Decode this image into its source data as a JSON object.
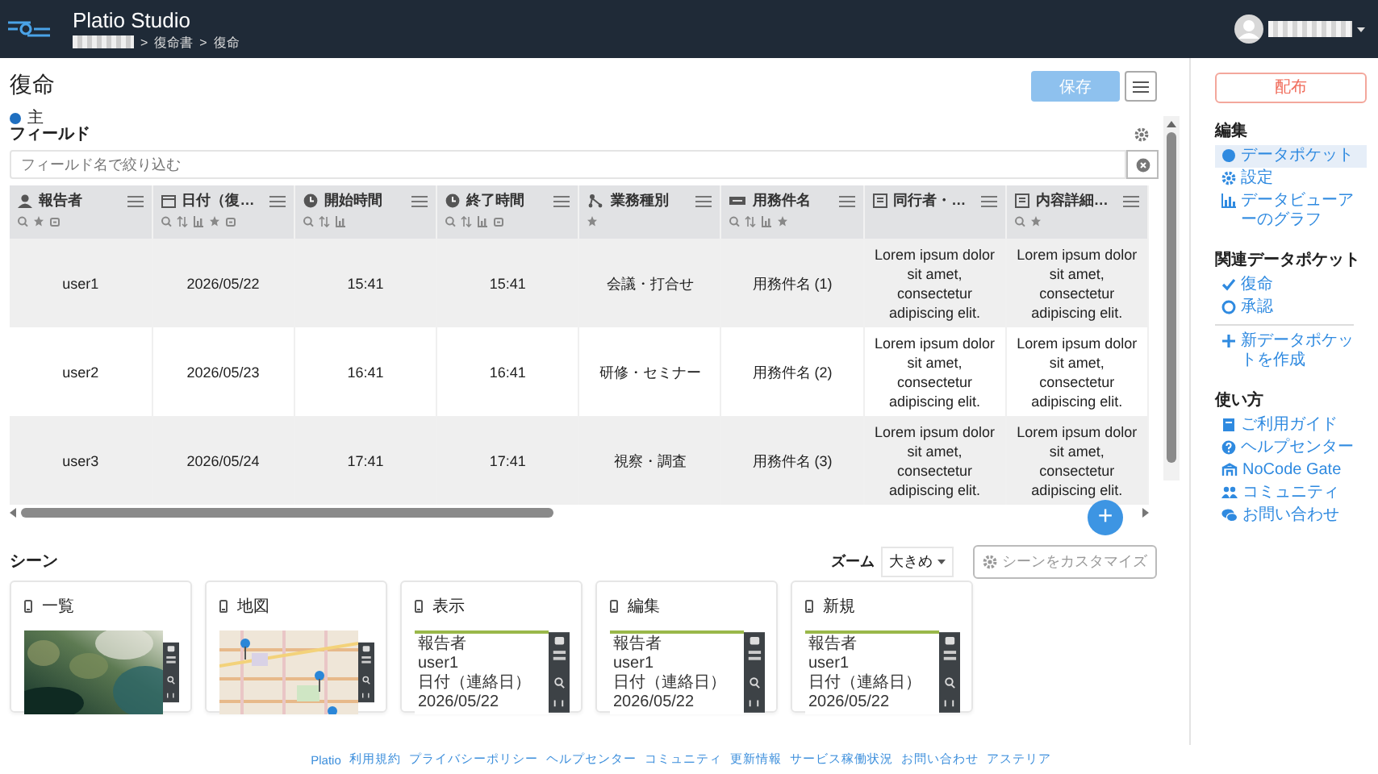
{
  "header": {
    "app_name": "Platio Studio",
    "breadcrumb": [
      "復命書",
      "復命"
    ],
    "separator": ">"
  },
  "page": {
    "title": "復命",
    "legend": {
      "label": "主",
      "color": "#1f6fc0"
    },
    "save_button": {
      "label": "保存",
      "disabled": true
    }
  },
  "fields": {
    "title": "フィールド",
    "filter_placeholder": "フィールド名で絞り込む"
  },
  "table": {
    "columns": [
      {
        "label": "報告者",
        "kind": "user",
        "searchable": true,
        "sortable": false,
        "chartable": false,
        "starred": true,
        "linked": true
      },
      {
        "label": "日付（復…",
        "kind": "date",
        "searchable": true,
        "sortable": true,
        "chartable": true,
        "starred": true,
        "linked": true
      },
      {
        "label": "開始時間",
        "kind": "time",
        "searchable": true,
        "sortable": true,
        "chartable": true,
        "starred": false,
        "linked": false
      },
      {
        "label": "終了時間",
        "kind": "time",
        "searchable": true,
        "sortable": true,
        "chartable": true,
        "starred": false,
        "linked": true
      },
      {
        "label": "業務種別",
        "kind": "choice",
        "searchable": false,
        "sortable": false,
        "chartable": false,
        "starred": true,
        "linked": false
      },
      {
        "label": "用務件名",
        "kind": "text",
        "searchable": true,
        "sortable": true,
        "chartable": true,
        "starred": true,
        "linked": false
      },
      {
        "label": "同行者・…",
        "kind": "longtext",
        "searchable": false,
        "sortable": false,
        "chartable": false,
        "starred": false,
        "linked": false
      },
      {
        "label": "内容詳細…",
        "kind": "longtext",
        "searchable": true,
        "sortable": false,
        "chartable": false,
        "starred": true,
        "linked": false
      }
    ],
    "rows": [
      {
        "cells": [
          "user1",
          "2026/05/22",
          "15:41",
          "15:41",
          "会議・打合せ",
          "用務件名 (1)",
          "Lorem ipsum dolor sit amet, consectetur adipiscing elit.",
          "Lorem ipsum dolor sit amet, consectetur adipiscing elit."
        ]
      },
      {
        "cells": [
          "user2",
          "2026/05/23",
          "16:41",
          "16:41",
          "研修・セミナー",
          "用務件名 (2)",
          "Lorem ipsum dolor sit amet, consectetur adipiscing elit.",
          "Lorem ipsum dolor sit amet, consectetur adipiscing elit."
        ]
      },
      {
        "cells": [
          "user3",
          "2026/05/24",
          "17:41",
          "17:41",
          "視察・調査",
          "用務件名 (3)",
          "Lorem ipsum dolor sit amet, consectetur adipiscing elit.",
          "Lorem ipsum dolor sit amet, consectetur adipiscing elit."
        ]
      }
    ],
    "add_button": "+"
  },
  "scenes": {
    "title": "シーン",
    "zoom_label": "ズーム",
    "zoom_value": "大きめ",
    "customize": "シーンをカスタマイズ",
    "cards": [
      {
        "title": "一覧",
        "kind": "list"
      },
      {
        "title": "地図",
        "kind": "map"
      },
      {
        "title": "表示",
        "kind": "form",
        "preview": [
          "報告者",
          "user1",
          "日付（連絡日）",
          "2026/05/22"
        ]
      },
      {
        "title": "編集",
        "kind": "form",
        "preview": [
          "報告者",
          "user1",
          "日付（連絡日）",
          "2026/05/22"
        ]
      },
      {
        "title": "新規",
        "kind": "form",
        "preview": [
          "報告者",
          "user1",
          "日付（連絡日）",
          "2026/05/22"
        ]
      }
    ]
  },
  "sidebar": {
    "deploy_button": "配布",
    "sections": [
      {
        "title": "編集",
        "items": [
          {
            "label": "データポケット",
            "kind": "dot",
            "selected": true
          },
          {
            "label": "設定",
            "kind": "gear",
            "selected": false
          },
          {
            "label": "データビューアーのグラフ",
            "kind": "chart",
            "selected": false
          }
        ]
      },
      {
        "title": "関連データポケット",
        "items": [
          {
            "label": "復命",
            "kind": "check",
            "selected": false
          },
          {
            "label": "承認",
            "kind": "circle",
            "selected": false
          },
          {
            "label": "新データポケットを作成",
            "kind": "plus",
            "selected": false
          }
        ]
      },
      {
        "title": "使い方",
        "items": [
          {
            "label": "ご利用ガイド",
            "kind": "book",
            "selected": false
          },
          {
            "label": "ヘルプセンター",
            "kind": "question",
            "selected": false
          },
          {
            "label": "NoCode Gate",
            "kind": "gate",
            "selected": false
          },
          {
            "label": "コミュニティ",
            "kind": "people",
            "selected": false
          },
          {
            "label": "お問い合わせ",
            "kind": "chat",
            "selected": false
          }
        ]
      }
    ]
  },
  "footer": {
    "links": [
      "Platio",
      "利用規約",
      "プライバシーポリシー",
      "ヘルプセンター",
      "コミュニティ",
      "更新情報",
      "サービス稼働状況",
      "お問い合わせ",
      "アステリア"
    ]
  }
}
